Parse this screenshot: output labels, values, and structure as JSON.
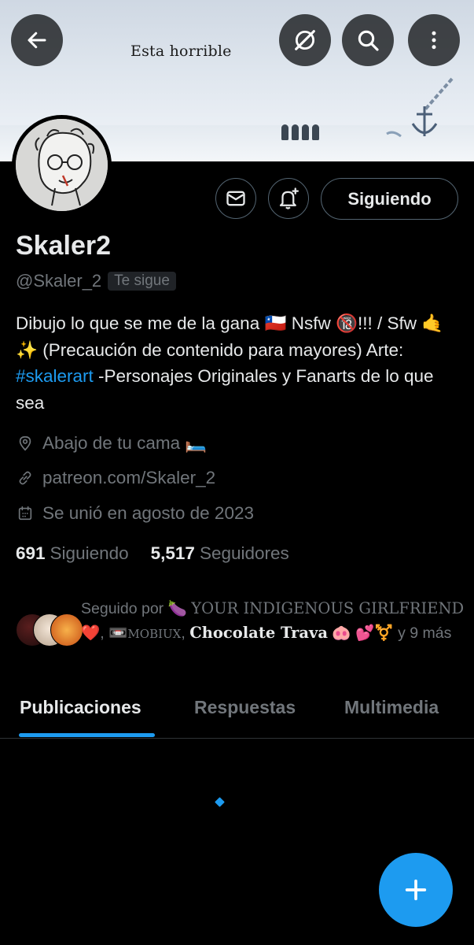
{
  "banner": {
    "text": "Esta horrible"
  },
  "top_bar": {
    "back_icon": "arrow-left-icon",
    "grok_icon": "grok-icon",
    "search_icon": "search-icon",
    "more_icon": "more-vertical-icon"
  },
  "profile": {
    "name": "Skaler2",
    "handle": "@Skaler_2",
    "follows_you": "Te sigue",
    "bio": {
      "part1": "Dibujo lo que se me de la gana 🇨🇱 Nsfw 🔞!!! / Sfw 🤙✨ (Precaución de contenido para mayores) Arte: ",
      "hashtag": "#skalerart",
      "part2": " -Personajes Originales y Fanarts de lo que sea"
    },
    "location": "Abajo de tu cama 🛏️",
    "website": "patreon.com/Skaler_2",
    "joined": "Se unió en agosto de 2023"
  },
  "actions": {
    "message_icon": "envelope-icon",
    "notify_icon": "bell-plus-icon",
    "follow_label": "Siguiendo"
  },
  "stats": {
    "following_count": "691",
    "following_label": "Siguiendo",
    "followers_count": "5,517",
    "followers_label": "Seguidores"
  },
  "followed_by": {
    "prefix": "Seguido por 🍆 ",
    "name1": "YOUR INDIGENOUS GIRLFRIEND",
    "after1": " ❤️, 📼",
    "name2": "MOBIUX",
    "sep": ", ",
    "name3": "Chocolate Trava",
    "suffix": " 🐽 💕⚧️ y 9 más"
  },
  "tabs": [
    {
      "label": "Publicaciones",
      "active": true
    },
    {
      "label": "Respuestas",
      "active": false
    },
    {
      "label": "Multimedia",
      "active": false
    }
  ],
  "fab": {
    "icon": "plus-icon"
  },
  "colors": {
    "accent": "#1d9bf0",
    "background": "#000000",
    "text_primary": "#e7e9ea",
    "text_secondary": "#71767b"
  }
}
